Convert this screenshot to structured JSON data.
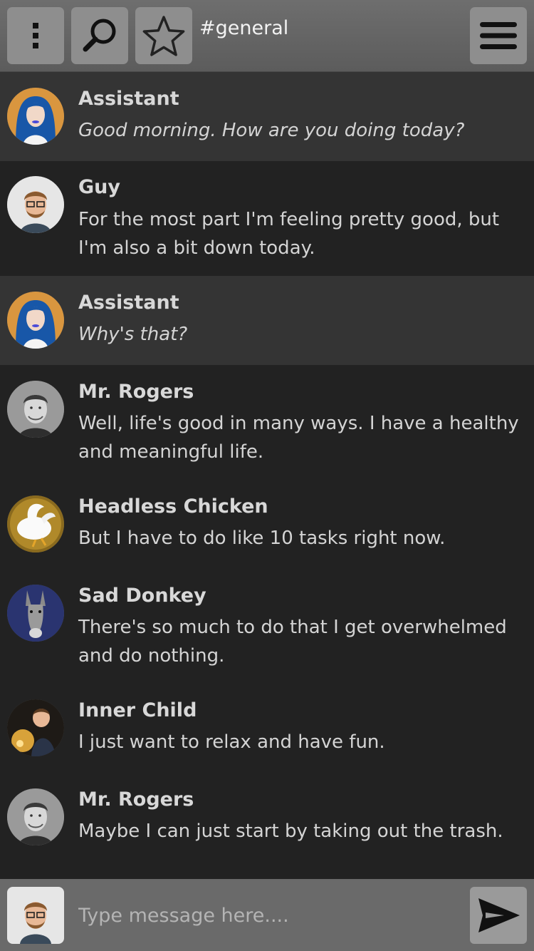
{
  "header": {
    "channel": "#general",
    "icons": [
      "kebab-menu-icon",
      "search-icon",
      "star-icon",
      "hamburger-menu-icon"
    ]
  },
  "messages": [
    {
      "author": "Assistant",
      "text": "Good morning. How are you doing today?",
      "avatar": "assistant-avatar",
      "style": "assistant"
    },
    {
      "author": "Guy",
      "text": "For the most part I'm feeling pretty good, but I'm also a bit down today.",
      "avatar": "guy-avatar",
      "style": "user"
    },
    {
      "author": "Assistant",
      "text": "Why's that?",
      "avatar": "assistant-avatar",
      "style": "assistant"
    },
    {
      "author": "Mr. Rogers",
      "text": "Well, life's good in many ways. I have a healthy and meaningful life.",
      "avatar": "mr-rogers-avatar",
      "style": "user"
    },
    {
      "author": "Headless Chicken",
      "text": "But I have to do like 10 tasks right now.",
      "avatar": "headless-chicken-avatar",
      "style": "user"
    },
    {
      "author": "Sad Donkey",
      "text": "There's so much to do that I get overwhelmed and do nothing.",
      "avatar": "sad-donkey-avatar",
      "style": "user"
    },
    {
      "author": "Inner Child",
      "text": "I just want to relax and have fun.",
      "avatar": "inner-child-avatar",
      "style": "user"
    },
    {
      "author": "Mr. Rogers",
      "text": "Maybe I can just start by taking out the trash.",
      "avatar": "mr-rogers-avatar",
      "style": "user"
    }
  ],
  "composer": {
    "placeholder": "Type message here....",
    "value": ""
  },
  "colors": {
    "background": "#222222",
    "assistant_row": "#343434",
    "topbar": "#666666",
    "button": "#8e8e8e"
  }
}
